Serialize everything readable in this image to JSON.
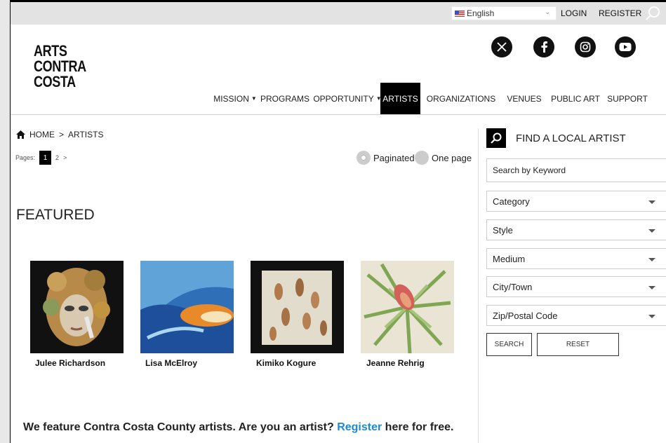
{
  "topbar": {
    "language": "English",
    "login": "LOGIN",
    "register": "REGISTER"
  },
  "logo": {
    "line1": "ARTS",
    "line2": "CONTRA",
    "line3": "COSTA"
  },
  "social": [
    "x-icon",
    "facebook-icon",
    "instagram-icon",
    "youtube-icon"
  ],
  "nav": {
    "mission": "MISSION",
    "programs": "PROGRAMS",
    "opportunity": "OPPORTUNITY",
    "artists": "ARTISTS",
    "organizations": "ORGANIZATIONS",
    "venues": "VENUES",
    "public_art": "PUBLIC ART",
    "support": "SUPPORT"
  },
  "breadcrumb": {
    "home": "HOME",
    "sep": ">",
    "current": "ARTISTS"
  },
  "pagination": {
    "label": "Pages:",
    "current": "1",
    "next_page": "2",
    "next": ">"
  },
  "view": {
    "paginated": "Paginated",
    "one_page": "One page"
  },
  "featured": {
    "heading": "FEATURED",
    "artists": [
      "Julee Richardson",
      "Lisa McElroy",
      "Kimiko Kogure",
      "Jeanne Rehrig"
    ]
  },
  "promo": {
    "pre": "We feature Contra Costa County artists. Are you an artist? ",
    "link": "Register",
    "post": " here for free."
  },
  "sidebar": {
    "title": "FIND A LOCAL ARTIST",
    "keyword_placeholder": "Search by Keyword",
    "category": "Category",
    "style": "Style",
    "medium": "Medium",
    "city": "City/Town",
    "zip": "Zip/Postal Code",
    "search_btn": "SEARCH",
    "reset_btn": "RESET"
  },
  "colors": {
    "active_nav": "#000000",
    "link": "#1b8ad3"
  }
}
